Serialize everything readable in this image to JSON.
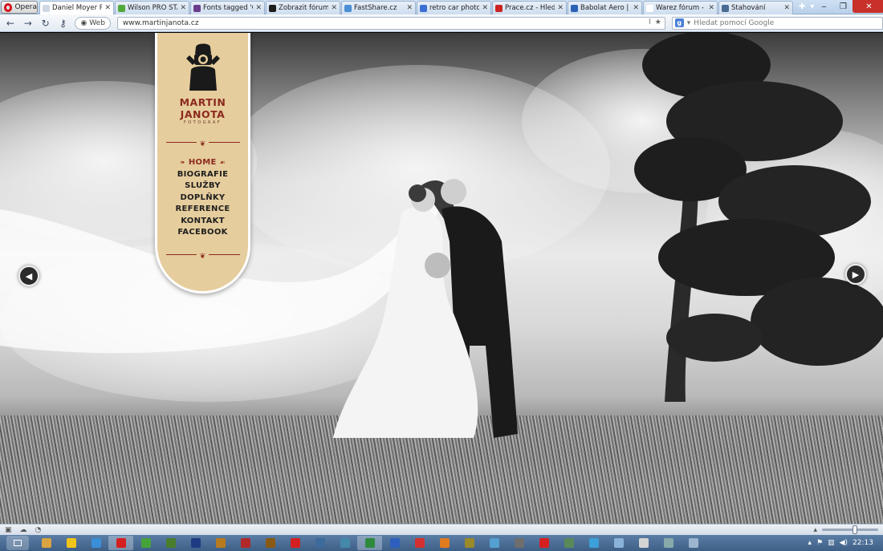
{
  "browser": {
    "menu_button": "Opera",
    "tabs": [
      {
        "title": "Daniel Moyer Pho...",
        "color": "#cfd8e2",
        "active": true
      },
      {
        "title": "Wilson PRO STAF...",
        "color": "#53a83a"
      },
      {
        "title": "Fonts tagged 'Cut...",
        "color": "#6b3b8d"
      },
      {
        "title": "Zobrazit fórum - ...",
        "color": "#1d1d1d"
      },
      {
        "title": "FastShare.cz",
        "color": "#4b8fd6"
      },
      {
        "title": "retro car photos a...",
        "color": "#3b6fd3"
      },
      {
        "title": "Prace.cz - Hledejt...",
        "color": "#cc2222"
      },
      {
        "title": "Babolat Aero | Ba...",
        "color": "#2b62b5"
      },
      {
        "title": "Warez fórum - hu...",
        "color": "#ffffff"
      },
      {
        "title": "Stahování",
        "color": "#4b6c92"
      }
    ],
    "web_badge": "Web",
    "url": "www.martinjanota.cz",
    "search_placeholder": "Hledat pomocí Google"
  },
  "site": {
    "brand_name": "MARTIN JANOTA",
    "brand_sub": "FOTOGRAF",
    "menu": [
      {
        "label": "HOME",
        "current": true
      },
      {
        "label": "BIOGRAFIE"
      },
      {
        "label": "SLUŽBY"
      },
      {
        "label": "DOPLŇKY"
      },
      {
        "label": "REFERENCE"
      },
      {
        "label": "KONTAKT"
      },
      {
        "label": "FACEBOOK"
      }
    ],
    "colors": {
      "panel": "#e6cd9d",
      "accent": "#8c2a1f"
    }
  },
  "taskbar": {
    "time": "22:13",
    "apps": [
      "#d9a441",
      "#f0c419",
      "#3a8fd9",
      "#d42020",
      "#46a33a",
      "#4b7e2c",
      "#1e3c84",
      "#b87a1f",
      "#b32929",
      "#8a5a14",
      "#d42020",
      "#3d6a9b",
      "#4488aa",
      "#2d8a3d",
      "#2e5fbf",
      "#d43030",
      "#e07b1f",
      "#9a8a2a",
      "#54a0d0",
      "#6e6e6e",
      "#d42020",
      "#5a8a5a",
      "#3d9fd9",
      "#8ab3d9",
      "#d4d4d4",
      "#8aa",
      "#9db5cf"
    ]
  }
}
